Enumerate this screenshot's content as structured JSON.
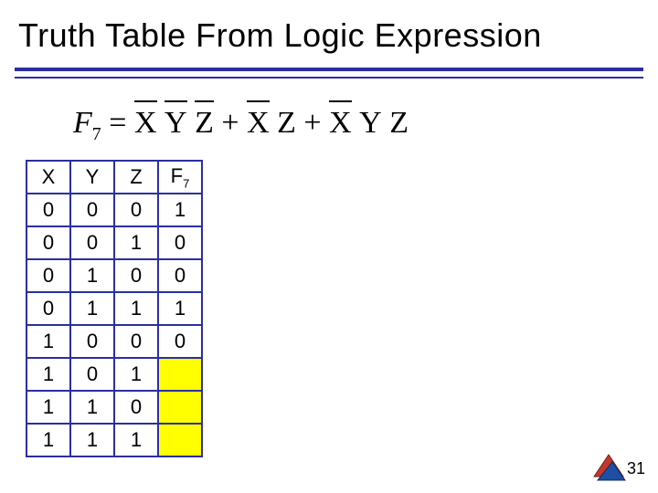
{
  "title": "Truth Table From Logic Expression",
  "formula": {
    "lhs_var": "F",
    "lhs_sub": "7",
    "eq": "=",
    "term1": {
      "x": "X",
      "y": "Y",
      "z": "Z",
      "xbar": true,
      "ybar": true,
      "zbar": true
    },
    "plus1": "+",
    "term2": {
      "x": "X",
      "z": "Z",
      "xbar": true,
      "zbar": false
    },
    "plus2": "+",
    "term3": {
      "x": "X",
      "y": "Y",
      "z": "Z",
      "xbar": true,
      "ybar": false,
      "zbar": false
    }
  },
  "table": {
    "headers": {
      "x": "X",
      "y": "Y",
      "z": "Z",
      "f": "F",
      "fsub": "7"
    },
    "rows": [
      {
        "x": "0",
        "y": "0",
        "z": "0",
        "f": "1",
        "hl": false
      },
      {
        "x": "0",
        "y": "0",
        "z": "1",
        "f": "0",
        "hl": false
      },
      {
        "x": "0",
        "y": "1",
        "z": "0",
        "f": "0",
        "hl": false
      },
      {
        "x": "0",
        "y": "1",
        "z": "1",
        "f": "1",
        "hl": false
      },
      {
        "x": "1",
        "y": "0",
        "z": "0",
        "f": "0",
        "hl": false
      },
      {
        "x": "1",
        "y": "0",
        "z": "1",
        "f": "",
        "hl": true
      },
      {
        "x": "1",
        "y": "1",
        "z": "0",
        "f": "",
        "hl": true
      },
      {
        "x": "1",
        "y": "1",
        "z": "1",
        "f": "",
        "hl": true
      }
    ]
  },
  "page_number": "31",
  "chart_data": {
    "type": "table",
    "title": "Truth Table From Logic Expression",
    "columns": [
      "X",
      "Y",
      "Z",
      "F7"
    ],
    "rows": [
      [
        "0",
        "0",
        "0",
        "1"
      ],
      [
        "0",
        "0",
        "1",
        "0"
      ],
      [
        "0",
        "1",
        "0",
        "0"
      ],
      [
        "0",
        "1",
        "1",
        "1"
      ],
      [
        "1",
        "0",
        "0",
        "0"
      ],
      [
        "1",
        "0",
        "1",
        ""
      ],
      [
        "1",
        "1",
        "0",
        ""
      ],
      [
        "1",
        "1",
        "1",
        ""
      ]
    ]
  }
}
